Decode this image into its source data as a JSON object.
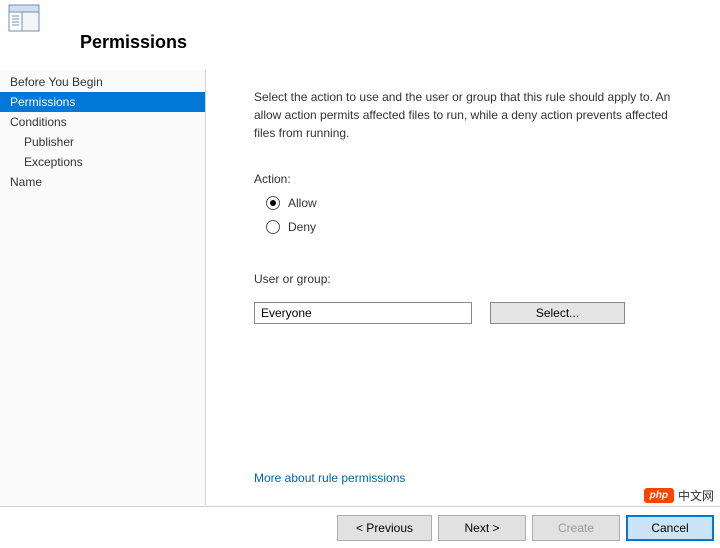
{
  "header": {
    "title": "Permissions"
  },
  "sidebar": {
    "items": [
      {
        "label": "Before You Begin"
      },
      {
        "label": "Permissions"
      },
      {
        "label": "Conditions"
      },
      {
        "label": "Name"
      }
    ],
    "sub_conditions": [
      {
        "label": "Publisher"
      },
      {
        "label": "Exceptions"
      }
    ]
  },
  "content": {
    "description": "Select the action to use and the user or group that this rule should apply to. An allow action permits affected files to run, while a deny action prevents affected files from running.",
    "action_label": "Action:",
    "radio_allow": "Allow",
    "radio_deny": "Deny",
    "user_group_label": "User or group:",
    "user_group_value": "Everyone",
    "select_button": "Select...",
    "more_link": "More about rule permissions"
  },
  "footer": {
    "previous": "< Previous",
    "next": "Next >",
    "create": "Create",
    "cancel": "Cancel"
  },
  "watermark": {
    "badge": "php",
    "text": "中文网"
  }
}
